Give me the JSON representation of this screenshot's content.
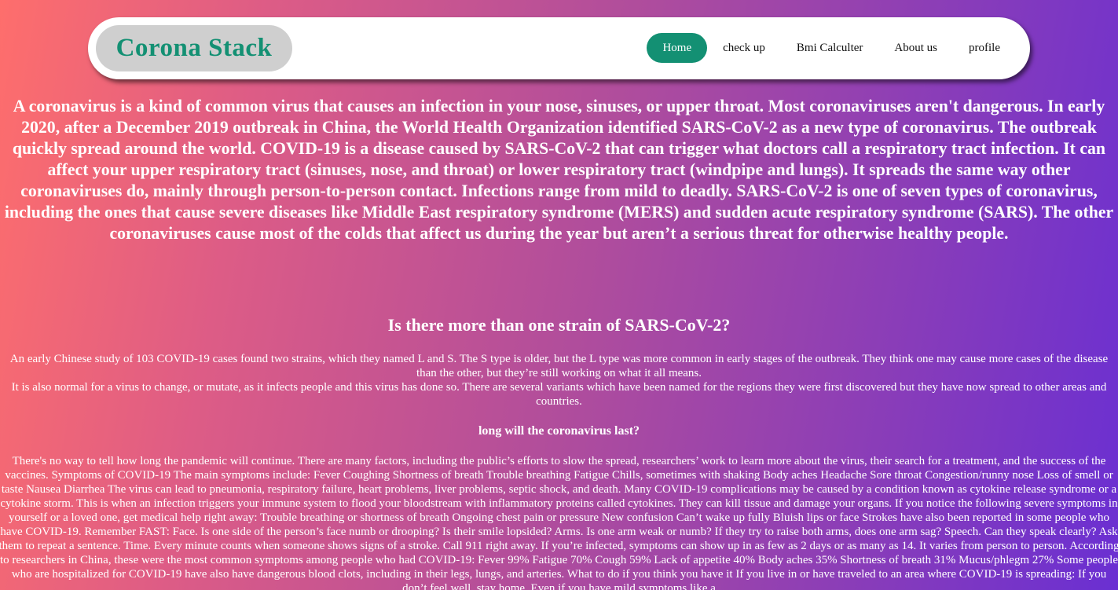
{
  "brand": "Corona Stack",
  "nav": {
    "home": "Home",
    "checkup": "check up",
    "bmi": "Bmi Calculter",
    "about": "About us",
    "profile": "profile"
  },
  "intro": "A coronavirus is a kind of common virus that causes an infection in your nose, sinuses, or upper throat. Most coronaviruses aren't dangerous. In early 2020, after a December 2019 outbreak in China, the World Health Organization identified SARS-CoV-2 as a new type of coronavirus. The outbreak quickly spread around the world. COVID-19 is a disease caused by SARS-CoV-2 that can trigger what doctors call a respiratory tract infection. It can affect your upper respiratory tract (sinuses, nose, and throat) or lower respiratory tract (windpipe and lungs). It spreads the same way other coronaviruses do, mainly through person-to-person contact. Infections range from mild to deadly. SARS-CoV-2 is one of seven types of coronavirus, including the ones that cause severe diseases like Middle East respiratory syndrome (MERS) and sudden acute respiratory syndrome (SARS). The other coronaviruses cause most of the colds that affect us during the year but aren’t a serious threat for otherwise healthy people.",
  "strains": {
    "heading": "Is there more than one strain of SARS-CoV-2?",
    "p1": "An early Chinese study of 103 COVID-19 cases found two strains, which they named L and S. The S type is older, but the L type was more common in early stages of the outbreak. They think one may cause more cases of the disease than the other, but they’re still working on what it all means.",
    "p2": "It is also normal for a virus to change, or mutate, as it infects people and this virus has done so. There are several variants which have been named for the regions they were first discovered but they have now spread to other areas and countries."
  },
  "duration": {
    "heading": "long will the coronavirus last?",
    "p": "There's no way to tell how long the pandemic will continue. There are many factors, including the public’s efforts to slow the spread, researchers’ work to learn more about the virus, their search for a treatment, and the success of the vaccines. Symptoms of COVID-19 The main symptoms include: Fever Coughing Shortness of breath Trouble breathing Fatigue Chills, sometimes with shaking Body aches Headache Sore throat Congestion/runny nose Loss of smell or taste Nausea Diarrhea The virus can lead to pneumonia, respiratory failure, heart problems, liver problems, septic shock, and death. Many COVID-19 complications may be caused by a condition known as cytokine release syndrome or a cytokine storm. This is when an infection triggers your immune system to flood your bloodstream with inflammatory proteins called cytokines. They can kill tissue and damage your organs. If you notice the following severe symptoms in yourself or a loved one, get medical help right away: Trouble breathing or shortness of breath Ongoing chest pain or pressure New confusion Can’t wake up fully Bluish lips or face Strokes have also been reported in some people who have COVID-19. Remember FAST: Face. Is one side of the person’s face numb or drooping? Is their smile lopsided? Arms. Is one arm weak or numb? If they try to raise both arms, does one arm sag? Speech. Can they speak clearly? Ask them to repeat a sentence. Time. Every minute counts when someone shows signs of a stroke. Call 911 right away. If you’re infected, symptoms can show up in as few as 2 days or as many as 14. It varies from person to person. According to researchers in China, these were the most common symptoms among people who had COVID-19: Fever 99% Fatigue 70% Cough 59% Lack of appetite 40% Body aches 35% Shortness of breath 31% Mucus/phlegm 27% Some people who are hospitalized for COVID-19 have also have dangerous blood clots, including in their legs, lungs, and arteries. What to do if you think you have it If you live in or have traveled to an area where COVID-19 is spreading: If you don’t feel well, stay home. Even if you have mild symptoms like a"
  }
}
